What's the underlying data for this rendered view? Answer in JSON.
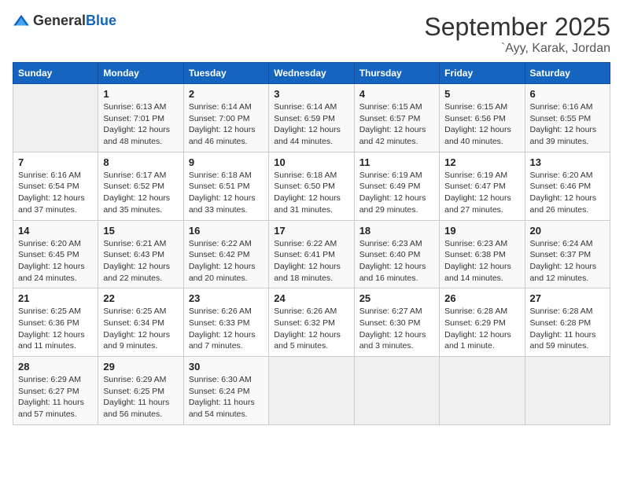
{
  "header": {
    "logo_general": "General",
    "logo_blue": "Blue",
    "month": "September 2025",
    "location": "`Ayy, Karak, Jordan"
  },
  "weekdays": [
    "Sunday",
    "Monday",
    "Tuesday",
    "Wednesday",
    "Thursday",
    "Friday",
    "Saturday"
  ],
  "weeks": [
    [
      {
        "day": "",
        "content": ""
      },
      {
        "day": "1",
        "content": "Sunrise: 6:13 AM\nSunset: 7:01 PM\nDaylight: 12 hours\nand 48 minutes."
      },
      {
        "day": "2",
        "content": "Sunrise: 6:14 AM\nSunset: 7:00 PM\nDaylight: 12 hours\nand 46 minutes."
      },
      {
        "day": "3",
        "content": "Sunrise: 6:14 AM\nSunset: 6:59 PM\nDaylight: 12 hours\nand 44 minutes."
      },
      {
        "day": "4",
        "content": "Sunrise: 6:15 AM\nSunset: 6:57 PM\nDaylight: 12 hours\nand 42 minutes."
      },
      {
        "day": "5",
        "content": "Sunrise: 6:15 AM\nSunset: 6:56 PM\nDaylight: 12 hours\nand 40 minutes."
      },
      {
        "day": "6",
        "content": "Sunrise: 6:16 AM\nSunset: 6:55 PM\nDaylight: 12 hours\nand 39 minutes."
      }
    ],
    [
      {
        "day": "7",
        "content": "Sunrise: 6:16 AM\nSunset: 6:54 PM\nDaylight: 12 hours\nand 37 minutes."
      },
      {
        "day": "8",
        "content": "Sunrise: 6:17 AM\nSunset: 6:52 PM\nDaylight: 12 hours\nand 35 minutes."
      },
      {
        "day": "9",
        "content": "Sunrise: 6:18 AM\nSunset: 6:51 PM\nDaylight: 12 hours\nand 33 minutes."
      },
      {
        "day": "10",
        "content": "Sunrise: 6:18 AM\nSunset: 6:50 PM\nDaylight: 12 hours\nand 31 minutes."
      },
      {
        "day": "11",
        "content": "Sunrise: 6:19 AM\nSunset: 6:49 PM\nDaylight: 12 hours\nand 29 minutes."
      },
      {
        "day": "12",
        "content": "Sunrise: 6:19 AM\nSunset: 6:47 PM\nDaylight: 12 hours\nand 27 minutes."
      },
      {
        "day": "13",
        "content": "Sunrise: 6:20 AM\nSunset: 6:46 PM\nDaylight: 12 hours\nand 26 minutes."
      }
    ],
    [
      {
        "day": "14",
        "content": "Sunrise: 6:20 AM\nSunset: 6:45 PM\nDaylight: 12 hours\nand 24 minutes."
      },
      {
        "day": "15",
        "content": "Sunrise: 6:21 AM\nSunset: 6:43 PM\nDaylight: 12 hours\nand 22 minutes."
      },
      {
        "day": "16",
        "content": "Sunrise: 6:22 AM\nSunset: 6:42 PM\nDaylight: 12 hours\nand 20 minutes."
      },
      {
        "day": "17",
        "content": "Sunrise: 6:22 AM\nSunset: 6:41 PM\nDaylight: 12 hours\nand 18 minutes."
      },
      {
        "day": "18",
        "content": "Sunrise: 6:23 AM\nSunset: 6:40 PM\nDaylight: 12 hours\nand 16 minutes."
      },
      {
        "day": "19",
        "content": "Sunrise: 6:23 AM\nSunset: 6:38 PM\nDaylight: 12 hours\nand 14 minutes."
      },
      {
        "day": "20",
        "content": "Sunrise: 6:24 AM\nSunset: 6:37 PM\nDaylight: 12 hours\nand 12 minutes."
      }
    ],
    [
      {
        "day": "21",
        "content": "Sunrise: 6:25 AM\nSunset: 6:36 PM\nDaylight: 12 hours\nand 11 minutes."
      },
      {
        "day": "22",
        "content": "Sunrise: 6:25 AM\nSunset: 6:34 PM\nDaylight: 12 hours\nand 9 minutes."
      },
      {
        "day": "23",
        "content": "Sunrise: 6:26 AM\nSunset: 6:33 PM\nDaylight: 12 hours\nand 7 minutes."
      },
      {
        "day": "24",
        "content": "Sunrise: 6:26 AM\nSunset: 6:32 PM\nDaylight: 12 hours\nand 5 minutes."
      },
      {
        "day": "25",
        "content": "Sunrise: 6:27 AM\nSunset: 6:30 PM\nDaylight: 12 hours\nand 3 minutes."
      },
      {
        "day": "26",
        "content": "Sunrise: 6:28 AM\nSunset: 6:29 PM\nDaylight: 12 hours\nand 1 minute."
      },
      {
        "day": "27",
        "content": "Sunrise: 6:28 AM\nSunset: 6:28 PM\nDaylight: 11 hours\nand 59 minutes."
      }
    ],
    [
      {
        "day": "28",
        "content": "Sunrise: 6:29 AM\nSunset: 6:27 PM\nDaylight: 11 hours\nand 57 minutes."
      },
      {
        "day": "29",
        "content": "Sunrise: 6:29 AM\nSunset: 6:25 PM\nDaylight: 11 hours\nand 56 minutes."
      },
      {
        "day": "30",
        "content": "Sunrise: 6:30 AM\nSunset: 6:24 PM\nDaylight: 11 hours\nand 54 minutes."
      },
      {
        "day": "",
        "content": ""
      },
      {
        "day": "",
        "content": ""
      },
      {
        "day": "",
        "content": ""
      },
      {
        "day": "",
        "content": ""
      }
    ]
  ]
}
